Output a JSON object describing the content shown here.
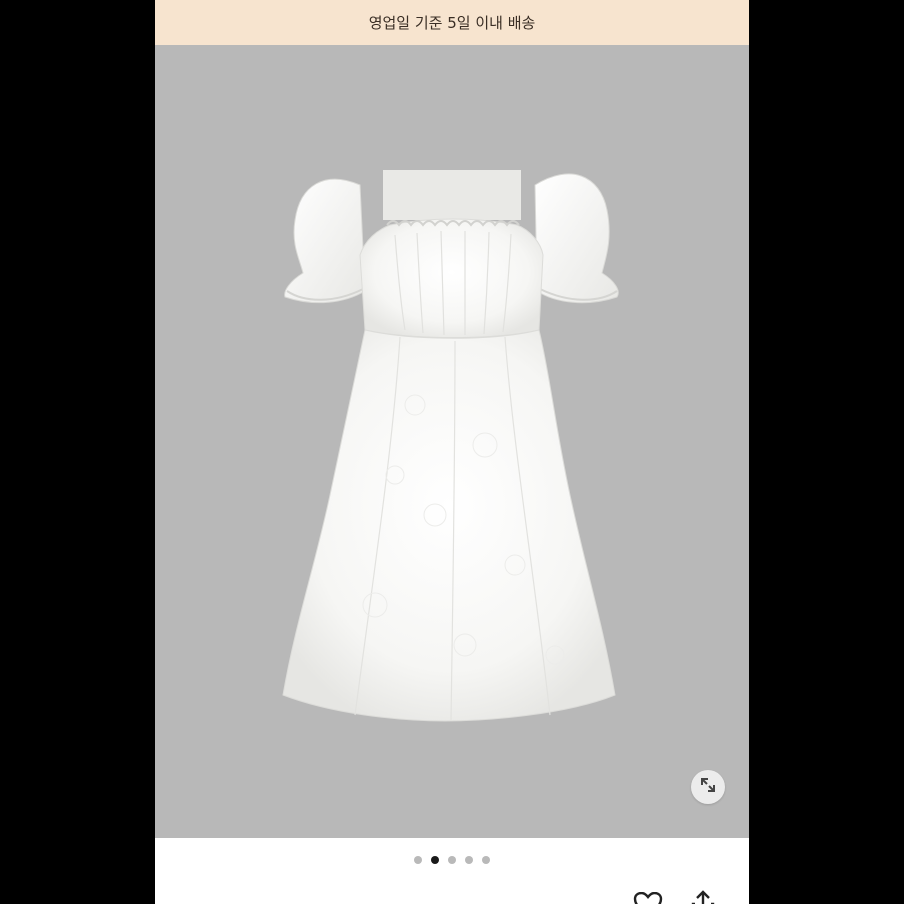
{
  "banner": {
    "text": "영업일 기준 5일 이내 배송"
  },
  "gallery": {
    "image_subject": "white-puff-sleeve-mini-dress",
    "expand_icon": "expand-icon",
    "pager": {
      "total": 5,
      "active": 2
    }
  },
  "product": {
    "title": "",
    "wish_icon": "heart-icon",
    "share_icon": "share-icon"
  },
  "colors": {
    "banner_bg": "#f7e4cf",
    "gallery_bg": "#b8b8b8",
    "dot_active": "#1a1a1a",
    "dot_inactive": "#b9b9b9"
  }
}
